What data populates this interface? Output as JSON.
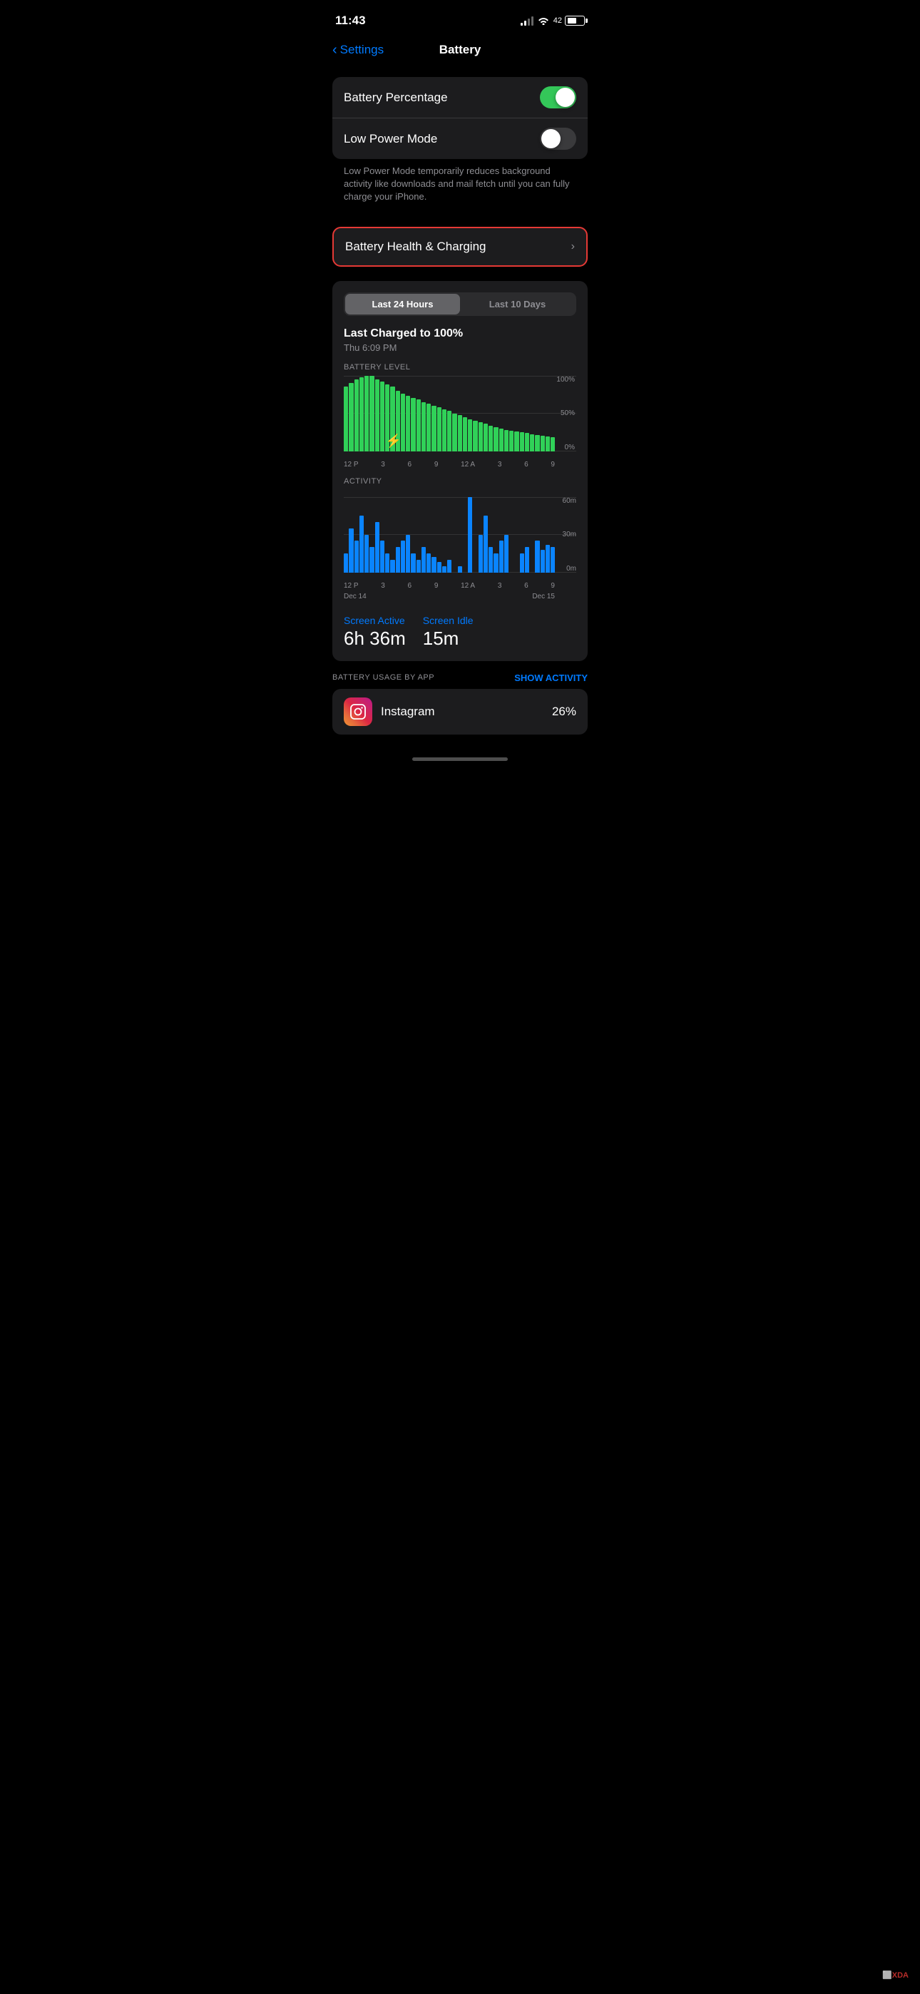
{
  "statusBar": {
    "time": "11:43",
    "batteryPercent": "42",
    "batteryLevel": 42
  },
  "nav": {
    "backLabel": "Settings",
    "title": "Battery"
  },
  "settings": {
    "batteryPercentageLabel": "Battery Percentage",
    "batteryPercentageOn": true,
    "lowPowerModeLabel": "Low Power Mode",
    "lowPowerModeOn": false,
    "lowPowerDescription": "Low Power Mode temporarily reduces background activity like downloads and mail fetch until you can fully charge your iPhone.",
    "batteryHealthLabel": "Battery Health & Charging"
  },
  "periodTabs": {
    "tab1": "Last 24 Hours",
    "tab2": "Last 10 Days",
    "activeTab": 0
  },
  "batteryChart": {
    "lastChargedTitle": "Last Charged to 100%",
    "lastChargedSubtitle": "Thu 6:09 PM",
    "chartLabel": "BATTERY LEVEL",
    "yLabels": [
      "100%",
      "50%",
      "0%"
    ],
    "xLabels": [
      "12 P",
      "3",
      "6",
      "9",
      "12 A",
      "3",
      "6",
      "9"
    ],
    "bars": [
      85,
      90,
      95,
      98,
      100,
      100,
      95,
      92,
      88,
      85,
      80,
      76,
      73,
      70,
      68,
      65,
      63,
      60,
      58,
      55,
      53,
      50,
      48,
      45,
      42,
      40,
      38,
      36,
      34,
      32,
      30,
      28,
      27,
      26,
      25,
      24,
      22,
      21,
      20,
      19,
      18
    ]
  },
  "activityChart": {
    "label": "ACTIVITY",
    "yLabels": [
      "60m",
      "30m",
      "0m"
    ],
    "xLabels": [
      "12 P",
      "3",
      "6",
      "9",
      "12 A",
      "3",
      "6",
      "9"
    ],
    "dateLabels": [
      "Dec 14",
      "Dec 15"
    ],
    "bars": [
      15,
      35,
      25,
      45,
      30,
      20,
      40,
      25,
      15,
      10,
      20,
      25,
      30,
      15,
      10,
      20,
      15,
      12,
      8,
      5,
      10,
      0,
      5,
      0,
      60,
      0,
      30,
      45,
      20,
      15,
      25,
      30,
      0,
      0,
      15,
      20,
      0,
      25,
      18,
      22,
      20
    ]
  },
  "screenUsage": {
    "activeLabel": "Screen Active",
    "activeValue": "6h 36m",
    "idleLabel": "Screen Idle",
    "idleValue": "15m"
  },
  "batteryUsage": {
    "sectionTitle": "BATTERY USAGE BY APP",
    "showActivityLabel": "SHOW ACTIVITY",
    "apps": [
      {
        "name": "Instagram",
        "percent": "26%",
        "icon": "instagram"
      }
    ]
  }
}
